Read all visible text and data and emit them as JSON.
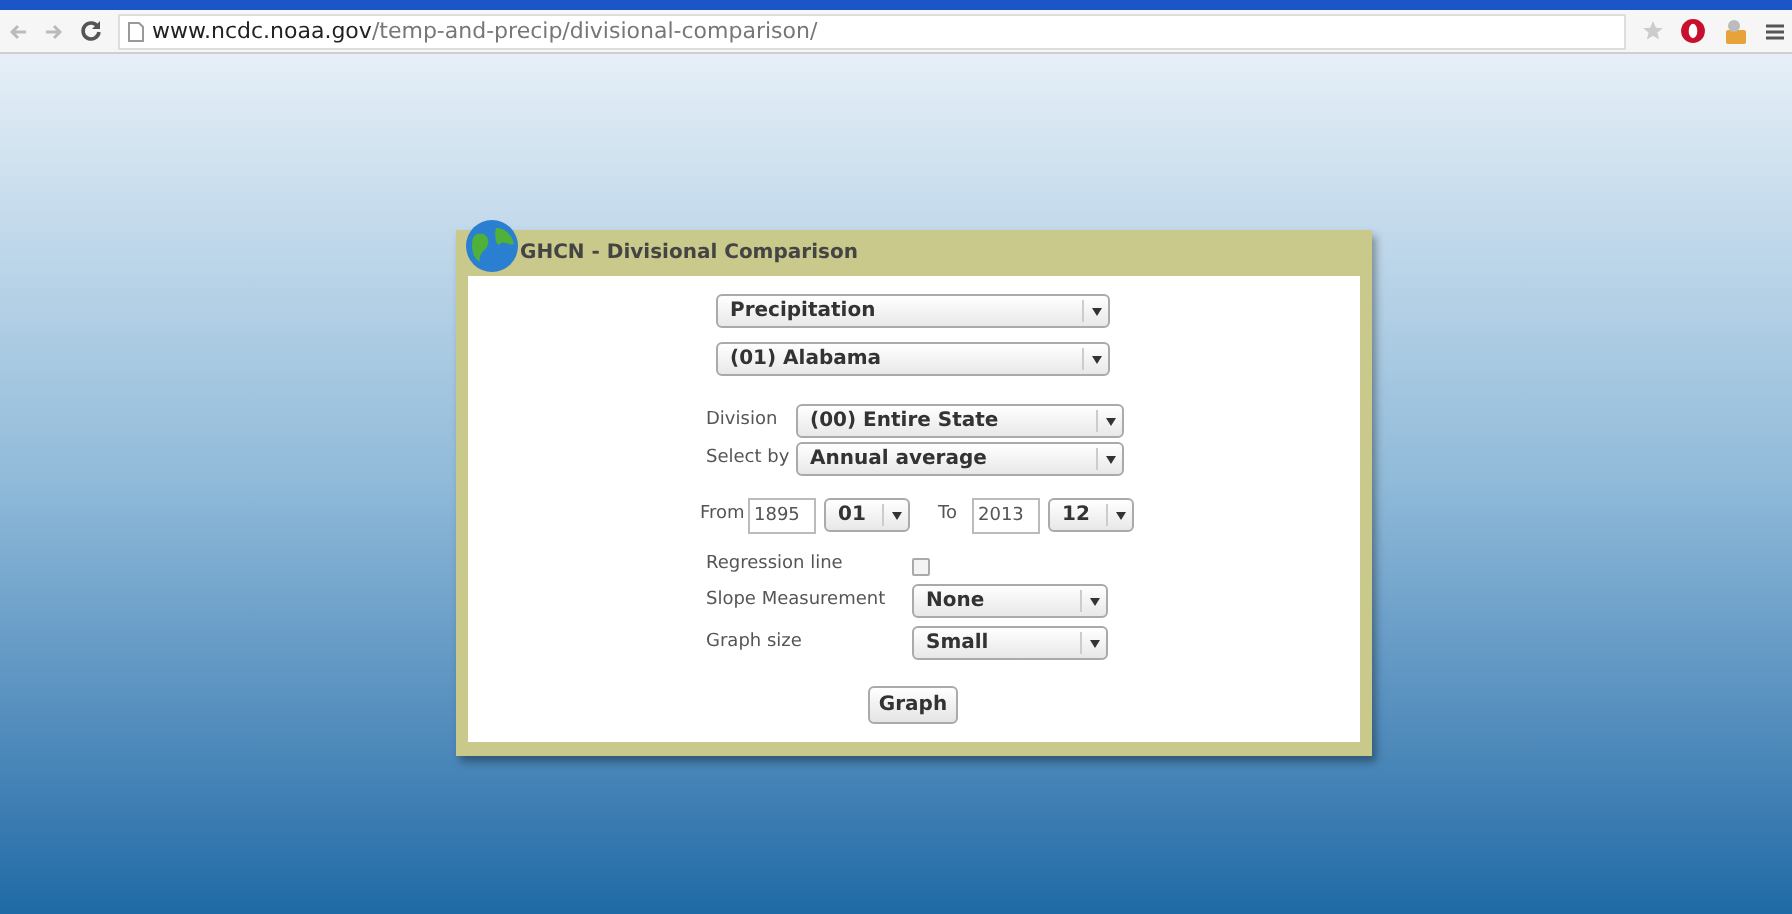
{
  "browser": {
    "url_host": "www.ncdc.noaa.gov",
    "url_path": "/temp-and-precip/divisional-comparison/"
  },
  "panel": {
    "title": "GHCN - Divisional Comparison",
    "top_selects": [
      {
        "value": "Precipitation"
      },
      {
        "value": "(01) Alabama"
      }
    ],
    "labelled_selects": [
      {
        "label": "Division",
        "value": "(00) Entire State"
      },
      {
        "label": "Select by",
        "value": "Annual average"
      }
    ],
    "date_range": {
      "from_label": "From",
      "from_year": "1895",
      "from_month": "01",
      "to_label": "To",
      "to_year": "2013",
      "to_month": "12"
    },
    "options": [
      {
        "kind": "checkbox",
        "label": "Regression line",
        "checked": false
      },
      {
        "kind": "select",
        "label": "Slope Measurement",
        "value": "None"
      },
      {
        "kind": "select",
        "label": "Graph size",
        "value": "Small"
      }
    ],
    "button": "Graph"
  }
}
